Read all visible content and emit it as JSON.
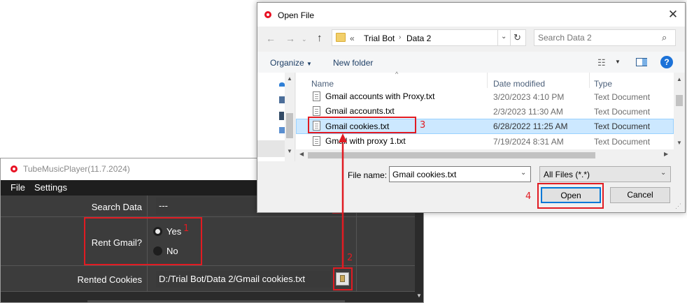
{
  "app": {
    "title": "TubeMusicPlayer(11.7.2024)",
    "menu": [
      "File",
      "Settings"
    ],
    "search_data": {
      "label": "Search Data",
      "value": "---"
    },
    "rent_gmail": {
      "label": "Rent Gmail?",
      "options": [
        "Yes",
        "No"
      ],
      "selected": "Yes"
    },
    "rented_cookies": {
      "label": "Rented Cookies",
      "value": "D:/Trial Bot/Data 2/Gmail cookies.txt"
    }
  },
  "dialog": {
    "title": "Open File",
    "close": "✕",
    "breadcrumb": {
      "prefix": "«",
      "parts": [
        "Trial Bot",
        "Data 2"
      ]
    },
    "search_placeholder": "Search Data 2",
    "toolbar": {
      "organize": "Organize",
      "new_folder": "New folder"
    },
    "columns": {
      "name": "Name",
      "date": "Date modified",
      "type": "Type"
    },
    "files": [
      {
        "name": "Gmail accounts with Proxy.txt",
        "date": "3/20/2023 4:10 PM",
        "type": "Text Document"
      },
      {
        "name": "Gmail accounts.txt",
        "date": "2/3/2023 11:30 AM",
        "type": "Text Document"
      },
      {
        "name": "Gmail cookies.txt",
        "date": "6/28/2022 11:25 AM",
        "type": "Text Document"
      },
      {
        "name": "Gmail with proxy 1.txt",
        "date": "7/19/2024 8:31 AM",
        "type": "Text Document"
      }
    ],
    "selected_file": "Gmail cookies.txt",
    "file_name_label": "File name:",
    "file_name_value": "Gmail cookies.txt",
    "filter": "All Files (*.*)",
    "open_label": "Open",
    "cancel_label": "Cancel"
  },
  "annotations": [
    "1",
    "2",
    "3",
    "4"
  ],
  "colors": {
    "annotation": "#e11b22",
    "selection": "#cce8ff",
    "app_bg": "#2b2b2b",
    "help": "#1c72d8"
  }
}
